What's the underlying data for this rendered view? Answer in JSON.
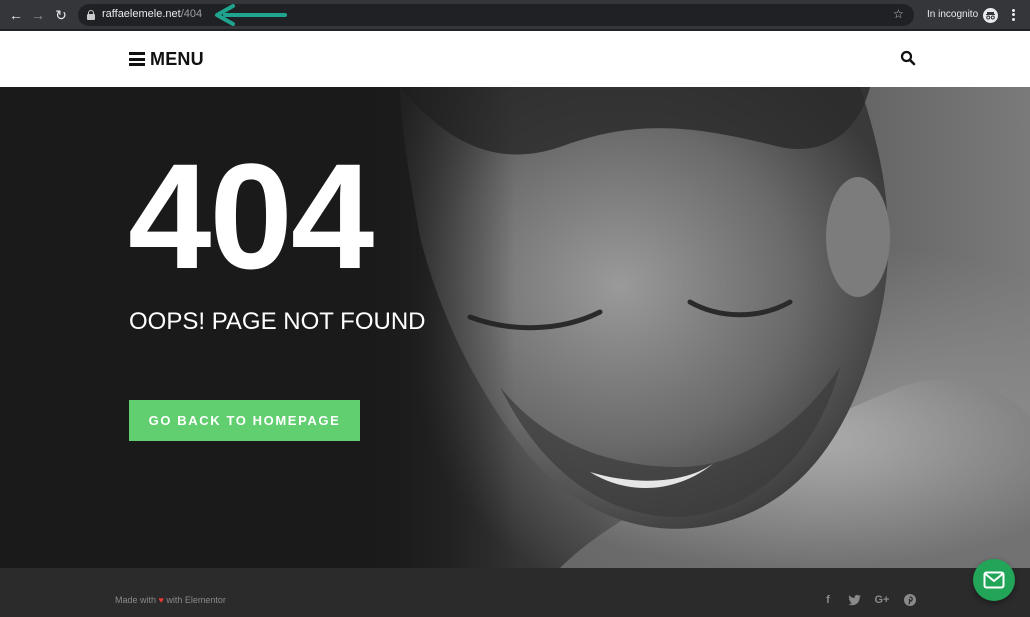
{
  "browser": {
    "url_host": "raffaelemele.net",
    "url_path": "/404",
    "incognito_label": "In incognito",
    "icons": [
      "back-arrow-icon",
      "forward-arrow-icon",
      "reload-icon",
      "lock-icon",
      "bookmark-star-icon",
      "incognito-icon",
      "kebab-menu-icon"
    ],
    "annotation_arrow_color": "#1fa58f"
  },
  "header": {
    "menu_label": "MENU",
    "icons": [
      "hamburger-icon",
      "search-icon"
    ]
  },
  "hero": {
    "code": "404",
    "message": "OOPS! PAGE NOT FOUND",
    "button_label": "GO BACK TO HOMEPAGE",
    "button_color": "#61ce70"
  },
  "footer": {
    "credit_prefix": "Made with",
    "credit_heart": "♥",
    "credit_suffix": "with Elementor",
    "social": [
      {
        "name": "facebook-icon",
        "glyph": "f"
      },
      {
        "name": "twitter-icon",
        "glyph": "🐦"
      },
      {
        "name": "google-plus-icon",
        "glyph": "G+"
      },
      {
        "name": "pinterest-icon",
        "glyph": "P"
      }
    ],
    "chat_button_color": "#22a559"
  }
}
